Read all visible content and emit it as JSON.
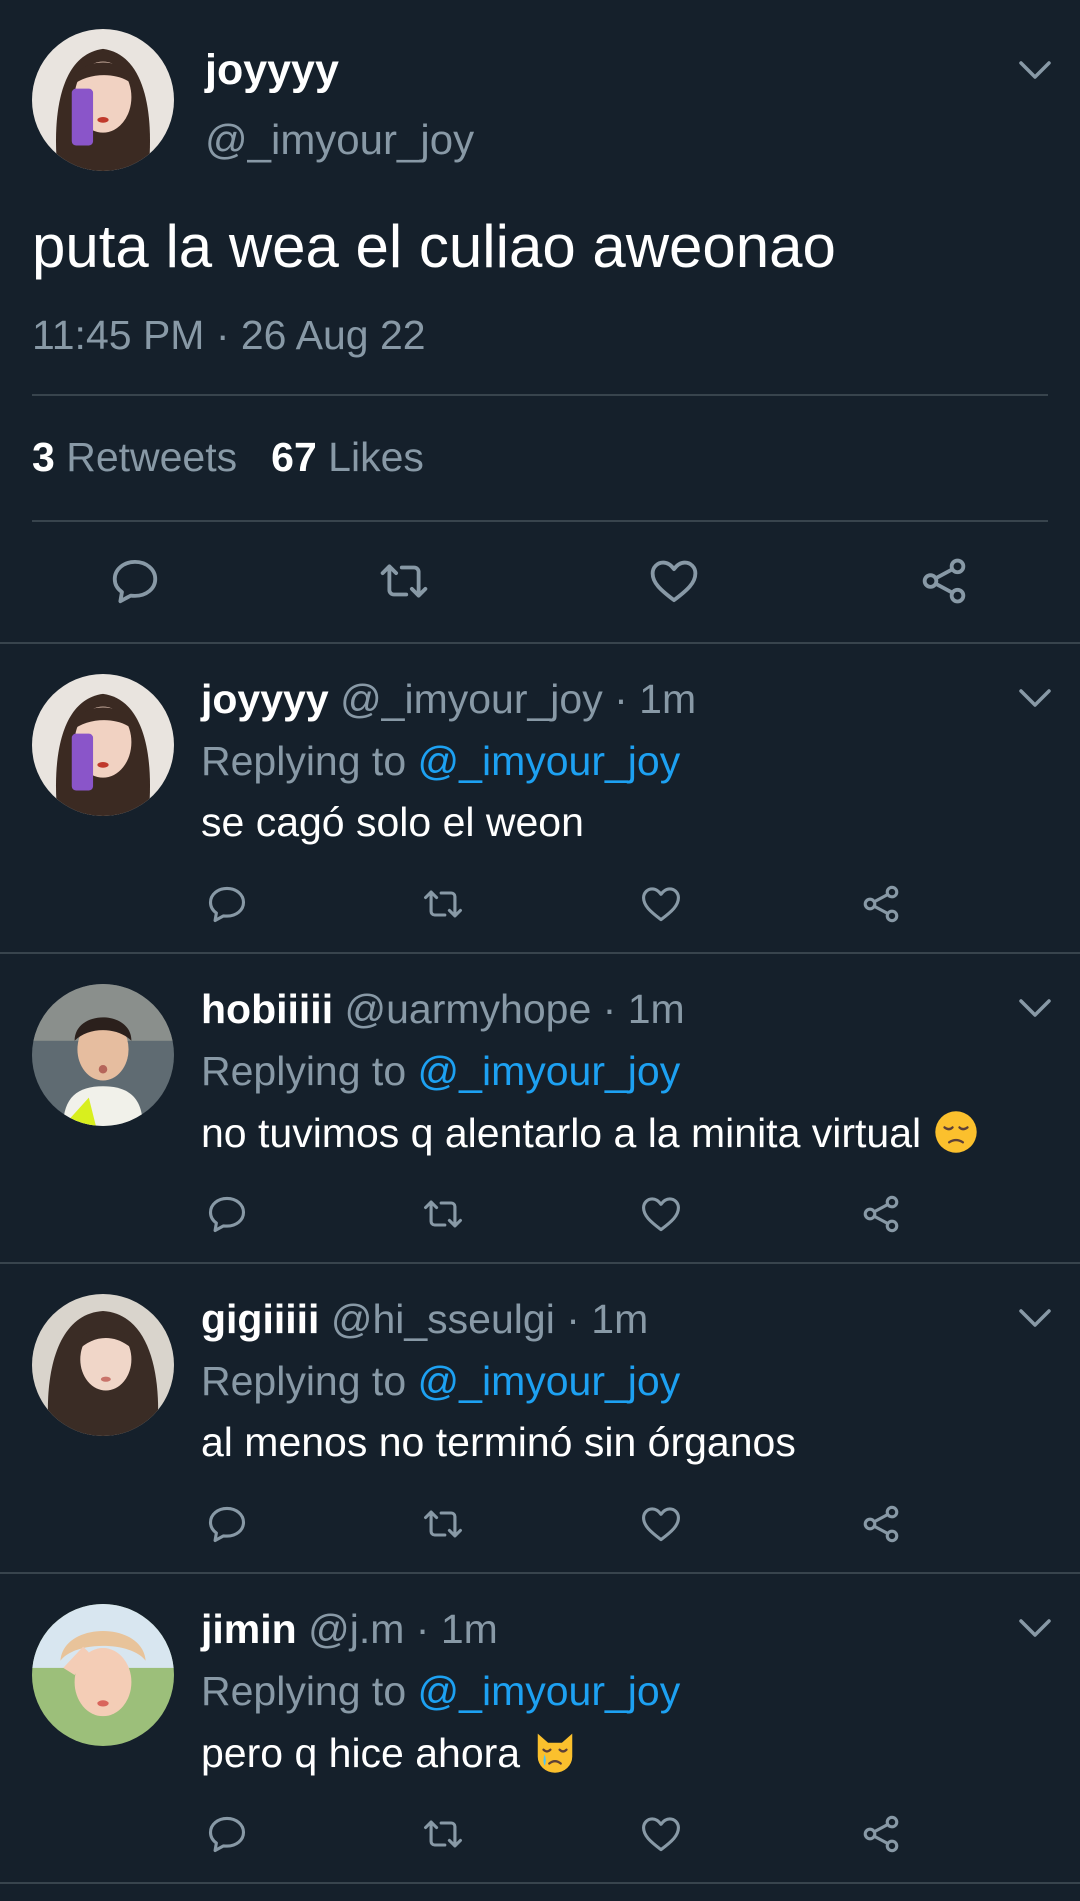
{
  "main_tweet": {
    "display_name": "joyyyy",
    "handle": "@_imyour_joy",
    "text": "puta la wea el culiao aweonao",
    "timestamp": "11:45 PM · 26 Aug 22",
    "retweets_count": "3",
    "retweets_label": "Retweets",
    "likes_count": "67",
    "likes_label": "Likes",
    "actions": [
      "reply-icon",
      "retweet-icon",
      "like-icon",
      "share-icon"
    ]
  },
  "replying_prefix": "Replying to",
  "replies": [
    {
      "display_name": "joyyyy",
      "handle": "@_imyour_joy",
      "time": "· 1m",
      "replying_to": "@_imyour_joy",
      "text": "se cagó solo el weon",
      "emoji": ""
    },
    {
      "display_name": "hobiiiii",
      "handle": "@uarmyhope",
      "time": "· 1m",
      "replying_to": "@_imyour_joy",
      "text": "no tuvimos q alentarlo a la minita virtual",
      "emoji": "disappointed-face"
    },
    {
      "display_name": "gigiiiii",
      "handle": "@hi_sseulgi",
      "time": "· 1m",
      "replying_to": "@_imyour_joy",
      "text": "al menos no terminó sin órganos",
      "emoji": ""
    },
    {
      "display_name": "jimin",
      "handle": "@j.m",
      "time": "· 1m",
      "replying_to": "@_imyour_joy",
      "text": "pero q hice ahora",
      "emoji": "crying-cat-face"
    }
  ],
  "colors": {
    "background": "#15202b",
    "divider": "#38444d",
    "secondary_text": "#8899a6",
    "link": "#1da1f2"
  }
}
